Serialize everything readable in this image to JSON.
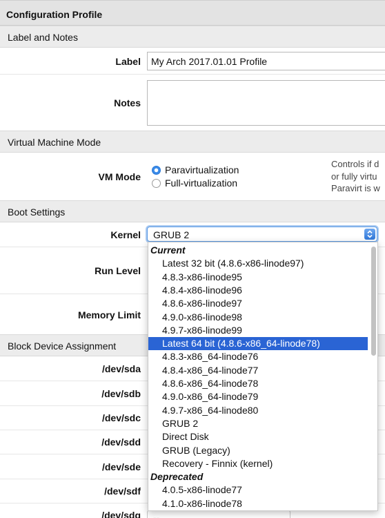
{
  "title": "Configuration Profile",
  "sections": {
    "label_notes": "Label and Notes",
    "vm_mode": "Virtual Machine Mode",
    "boot": "Boot Settings",
    "block": "Block Device Assignment"
  },
  "label_field": {
    "label": "Label",
    "value": "My Arch 2017.01.01 Profile"
  },
  "notes_field": {
    "label": "Notes",
    "value": ""
  },
  "vm_mode": {
    "label": "VM Mode",
    "options": [
      "Paravirtualization",
      "Full-virtualization"
    ],
    "selected": "Paravirtualization",
    "help": [
      "Controls if d",
      "or fully virtu",
      "Paravirt is w"
    ]
  },
  "kernel": {
    "label": "Kernel",
    "value": "GRUB 2",
    "options": [
      {
        "text": "Current",
        "group": true
      },
      {
        "text": "Latest 32 bit (4.8.6-x86-linode97)"
      },
      {
        "text": "4.8.3-x86-linode95"
      },
      {
        "text": "4.8.4-x86-linode96"
      },
      {
        "text": "4.8.6-x86-linode97"
      },
      {
        "text": "4.9.0-x86-linode98"
      },
      {
        "text": "4.9.7-x86-linode99"
      },
      {
        "text": "Latest 64 bit (4.8.6-x86_64-linode78)",
        "selected": true
      },
      {
        "text": "4.8.3-x86_64-linode76"
      },
      {
        "text": "4.8.4-x86_64-linode77"
      },
      {
        "text": "4.8.6-x86_64-linode78"
      },
      {
        "text": "4.9.0-x86_64-linode79"
      },
      {
        "text": "4.9.7-x86_64-linode80"
      },
      {
        "text": "GRUB 2"
      },
      {
        "text": "Direct Disk"
      },
      {
        "text": "GRUB (Legacy)"
      },
      {
        "text": "Recovery - Finnix (kernel)"
      },
      {
        "text": "Deprecated",
        "group": true
      },
      {
        "text": "4.0.5-x86-linode77"
      },
      {
        "text": "4.1.0-x86-linode78"
      }
    ]
  },
  "run_level": {
    "label": "Run Level"
  },
  "memory_limit": {
    "label": "Memory Limit"
  },
  "devices": [
    "/dev/sda",
    "/dev/sdb",
    "/dev/sdc",
    "/dev/sdd",
    "/dev/sde",
    "/dev/sdf",
    "/dev/sdg"
  ],
  "sdg_select_value": "--",
  "colors": {
    "accent": "#2a64d4",
    "header_bg": "#e3e3e3"
  }
}
